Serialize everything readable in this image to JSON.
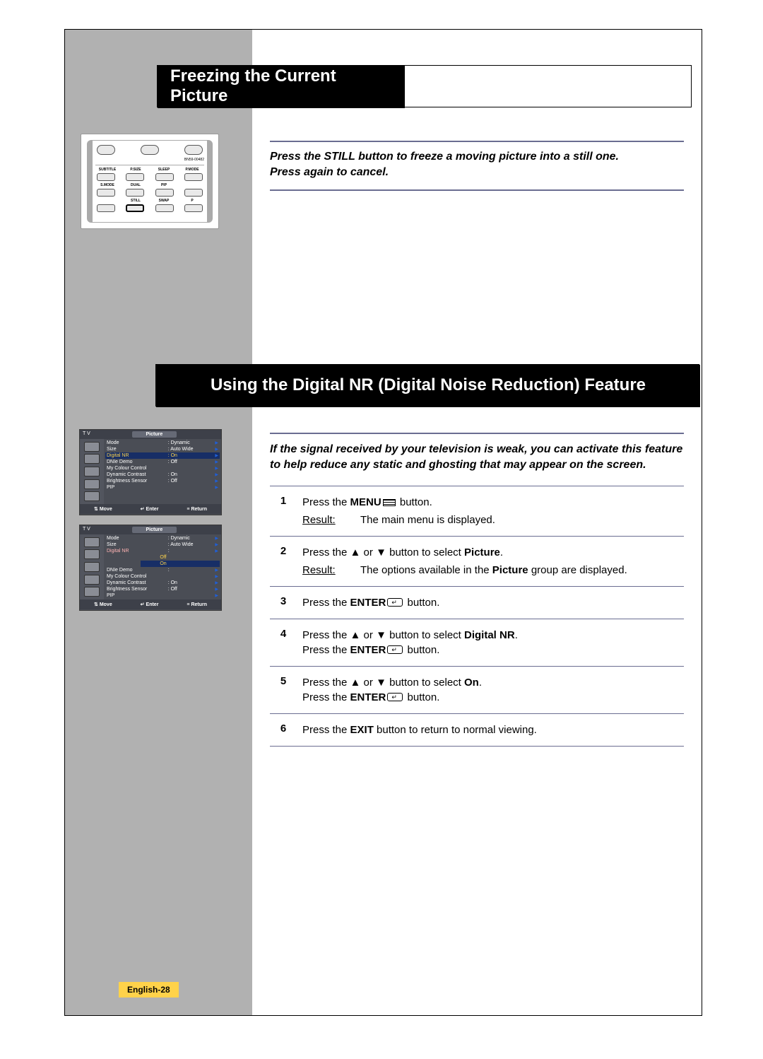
{
  "section1_title": "Freezing the Current Picture",
  "section2_title": "Using the Digital NR (Digital Noise Reduction) Feature",
  "intro1_line1": "Press the STILL button to freeze a moving picture into a still one.",
  "intro1_line2": "Press again to cancel.",
  "intro2": "If the signal received by your television is weak, you can activate this feature to help reduce any static and ghosting that may appear on the screen.",
  "remote": {
    "serial": "BN59-00482",
    "labels_row1": [
      "SUBTITLE",
      "P.SIZE",
      "SLEEP",
      "P.MODE"
    ],
    "labels_row2": [
      "S.MODE",
      "DUAL",
      "PIP",
      ""
    ],
    "labels_row3": [
      "",
      "STILL",
      "SWAP",
      "P"
    ]
  },
  "steps": [
    {
      "num": "1",
      "text_pre": "Press the ",
      "bold1": "MENU",
      "icon": "menu",
      "text_post": " button.",
      "result": "The main menu is displayed."
    },
    {
      "num": "2",
      "text_pre": "Press the ",
      "arrows": true,
      "text_mid": " button to select ",
      "bold1": "Picture",
      "text_post": ".",
      "result_pre": "The options available in the ",
      "result_bold": "Picture",
      "result_post": " group are displayed."
    },
    {
      "num": "3",
      "text_pre": "Press the ",
      "bold1": "ENTER",
      "icon": "enter",
      "text_post": " button."
    },
    {
      "num": "4",
      "line1_pre": "Press the ",
      "arrows": true,
      "line1_mid": " button to select ",
      "line1_bold": "Digital NR",
      "line1_post": ".",
      "line2_pre": "Press the ",
      "line2_bold": "ENTER",
      "line2_icon": "enter",
      "line2_post": "   button."
    },
    {
      "num": "5",
      "line1_pre": "Press the ",
      "arrows": true,
      "line1_mid": " button to select ",
      "line1_bold": "On",
      "line1_post": ".",
      "line2_pre": "Press the ",
      "line2_bold": "ENTER",
      "line2_icon": "enter",
      "line2_post": " button."
    },
    {
      "num": "6",
      "text_pre": "Press the ",
      "bold1": "EXIT",
      "text_post": " button to return to normal viewing."
    }
  ],
  "osd": {
    "hdr_left": "T V",
    "hdr_title": "Picture",
    "rows1": [
      {
        "lbl": "Mode",
        "val": ": Dynamic"
      },
      {
        "lbl": "Size",
        "val": ": Auto Wide"
      },
      {
        "lbl": "Digital NR",
        "val": ": On",
        "sel": true
      },
      {
        "lbl": "DNIe Demo",
        "val": ": Off"
      },
      {
        "lbl": "My Colour Control",
        "val": ""
      },
      {
        "lbl": "Dynamic Contrast",
        "val": ": On"
      },
      {
        "lbl": "Brightness Sensor",
        "val": ": Off"
      },
      {
        "lbl": "PIP",
        "val": ""
      }
    ],
    "rows2": [
      {
        "lbl": "Mode",
        "val": ": Dynamic"
      },
      {
        "lbl": "Size",
        "val": ": Auto Wide"
      },
      {
        "lbl": "Digital NR",
        "val": ":",
        "red": true,
        "opt_off": "Off",
        "opt_on": "On"
      },
      {
        "lbl": "DNIe Demo",
        "val": ":"
      },
      {
        "lbl": "My Colour Control",
        "val": ""
      },
      {
        "lbl": "Dynamic Contrast",
        "val": ": On"
      },
      {
        "lbl": "Brightness Sensor",
        "val": ": Off"
      },
      {
        "lbl": "PIP",
        "val": ""
      }
    ],
    "ftr_move": "Move",
    "ftr_enter": "Enter",
    "ftr_return": "Return"
  },
  "page_num": "English-28"
}
